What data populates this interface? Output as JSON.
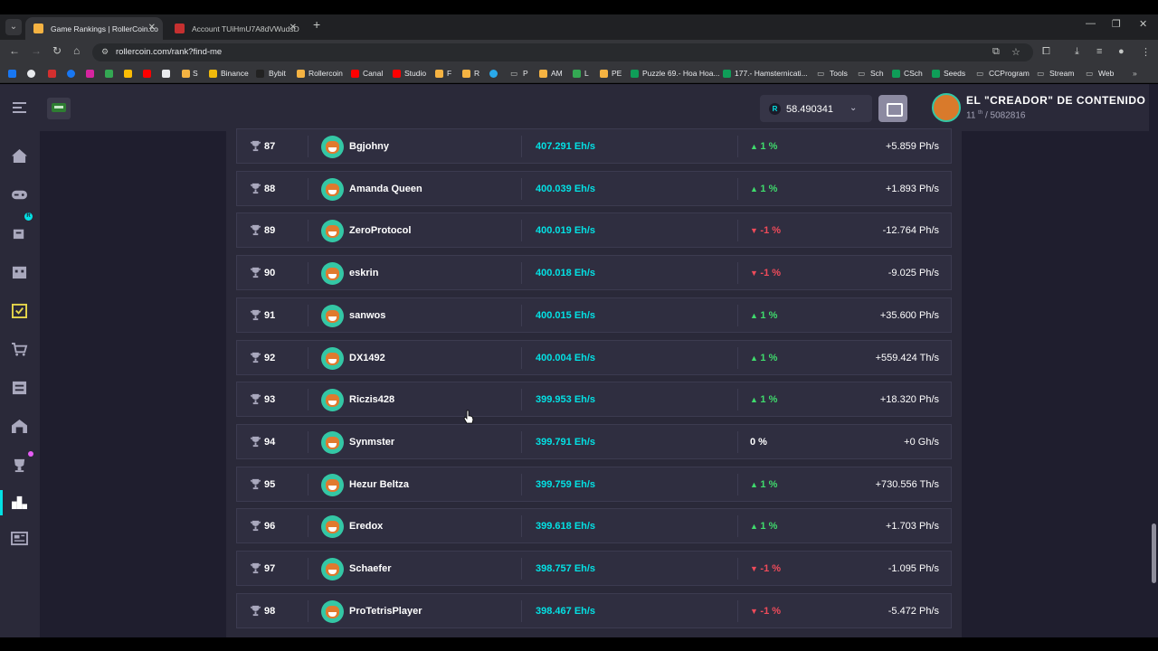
{
  "browser": {
    "tabs": [
      {
        "title": "Game Rankings | RollerCoin.co",
        "active": true
      },
      {
        "title": "Account TUiHmU7A8dVWudsD",
        "active": false
      }
    ],
    "url": "rollercoin.com/rank?find-me",
    "bookmarks": [
      "",
      "",
      "",
      "",
      "",
      "",
      "",
      "",
      "S",
      "Binance",
      "Bybit",
      "Rollercoin",
      "Canal",
      "Studio",
      "F",
      "R",
      "",
      "P",
      "AM",
      "L",
      "PE",
      "Puzzle 69.- Hoa Hoa...",
      "177.- Hamsternicati...",
      "Tools",
      "Sch",
      "CSch",
      "Seeds",
      "CCProgram",
      "Stream",
      "Web"
    ]
  },
  "header": {
    "balance_currency": "R",
    "balance": "58.490341",
    "user_name": "EL \"CREADOR\" DE CONTENIDO",
    "user_rank_pos": "11",
    "user_rank_suffix": "th",
    "user_rank_total": "/ 5082816"
  },
  "sidebar": {
    "items": [
      "home-icon",
      "games-icon",
      "mining-icon",
      "events-icon",
      "tasks-icon",
      "marketplace-icon",
      "storage-icon",
      "miners-icon",
      "rankings-icon",
      "leaderboard-icon",
      "news-icon"
    ],
    "active": "leaderboard-icon",
    "badge_text": "R"
  },
  "colors": {
    "accent": "#03e1e4",
    "up": "#3fdb6c",
    "down": "#ef4b5a",
    "panel": "#2a2939",
    "bg": "#1f1e2e"
  },
  "rankings": [
    {
      "rank": "87",
      "name": "Bgjohny",
      "power": "407.291 Eh/s",
      "change_dir": "up",
      "change": "1 %",
      "delta": "+5.859 Ph/s"
    },
    {
      "rank": "88",
      "name": "Amanda Queen",
      "power": "400.039 Eh/s",
      "change_dir": "up",
      "change": "1 %",
      "delta": "+1.893 Ph/s"
    },
    {
      "rank": "89",
      "name": "ZeroProtocol",
      "power": "400.019 Eh/s",
      "change_dir": "down",
      "change": "-1 %",
      "delta": "-12.764 Ph/s"
    },
    {
      "rank": "90",
      "name": "eskrin",
      "power": "400.018 Eh/s",
      "change_dir": "down",
      "change": "-1 %",
      "delta": "-9.025 Ph/s"
    },
    {
      "rank": "91",
      "name": "sanwos",
      "power": "400.015 Eh/s",
      "change_dir": "up",
      "change": "1 %",
      "delta": "+35.600 Ph/s"
    },
    {
      "rank": "92",
      "name": "DX1492",
      "power": "400.004 Eh/s",
      "change_dir": "up",
      "change": "1 %",
      "delta": "+559.424 Th/s"
    },
    {
      "rank": "93",
      "name": "Riczis428",
      "power": "399.953 Eh/s",
      "change_dir": "up",
      "change": "1 %",
      "delta": "+18.320 Ph/s"
    },
    {
      "rank": "94",
      "name": "Synmster",
      "power": "399.791 Eh/s",
      "change_dir": "flat",
      "change": "0 %",
      "delta": "+0 Gh/s"
    },
    {
      "rank": "95",
      "name": "Hezur Beltza",
      "power": "399.759 Eh/s",
      "change_dir": "up",
      "change": "1 %",
      "delta": "+730.556 Th/s"
    },
    {
      "rank": "96",
      "name": "Eredox",
      "power": "399.618 Eh/s",
      "change_dir": "up",
      "change": "1 %",
      "delta": "+1.703 Ph/s"
    },
    {
      "rank": "97",
      "name": "Schaefer",
      "power": "398.757 Eh/s",
      "change_dir": "down",
      "change": "-1 %",
      "delta": "-1.095 Ph/s"
    },
    {
      "rank": "98",
      "name": "ProTetrisPlayer",
      "power": "398.467 Eh/s",
      "change_dir": "down",
      "change": "-1 %",
      "delta": "-5.472 Ph/s"
    }
  ]
}
